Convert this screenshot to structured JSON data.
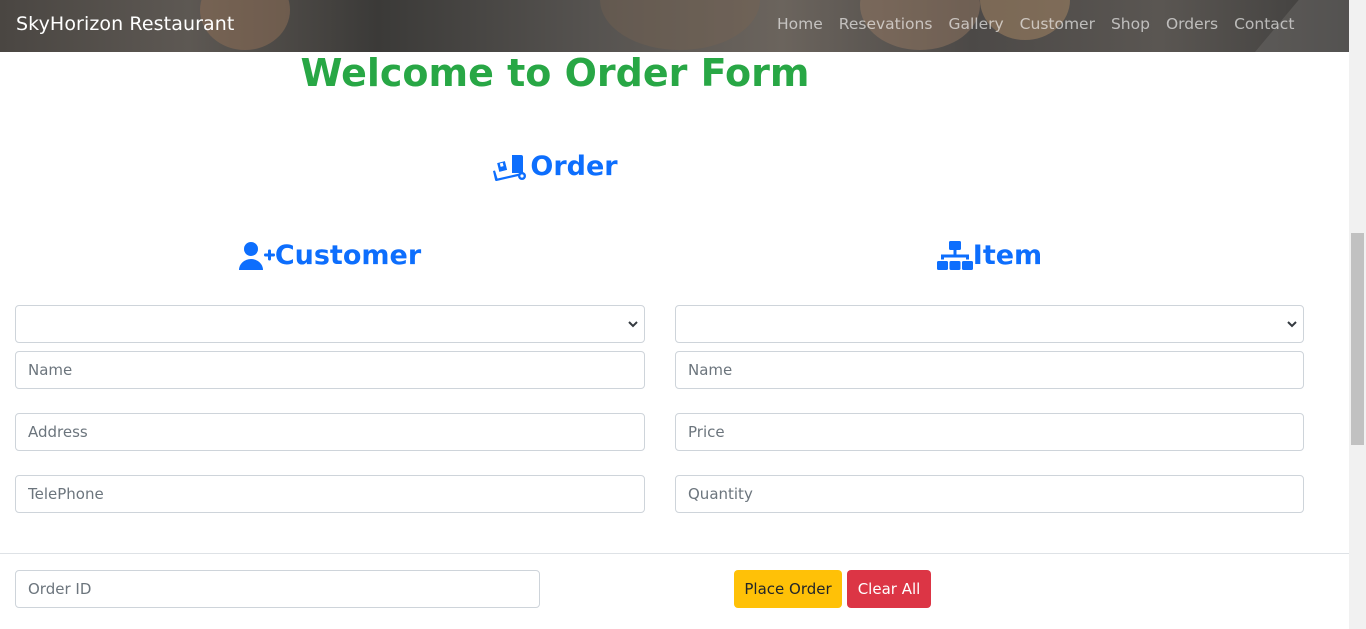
{
  "navbar": {
    "brand": "SkyHorizon Restaurant",
    "links": [
      "Home",
      "Resevations",
      "Gallery",
      "Customer",
      "Shop",
      "Orders",
      "Contact"
    ]
  },
  "page": {
    "welcome": "Welcome to Order Form",
    "order_heading": "Order",
    "customer_heading": "Customer",
    "item_heading": "Item"
  },
  "customer": {
    "select_value": "",
    "name_placeholder": "Name",
    "address_placeholder": "Address",
    "telephone_placeholder": "TelePhone"
  },
  "item": {
    "select_value": "",
    "name_placeholder": "Name",
    "price_placeholder": "Price",
    "quantity_placeholder": "Quantity"
  },
  "order": {
    "order_id_placeholder": "Order ID",
    "place_order_label": "Place Order",
    "clear_all_label": "Clear All"
  },
  "icons": {
    "order": "truck-loading-icon",
    "customer": "user-plus-icon",
    "item": "sitemap-icon",
    "select_arrow": "chevron-down-icon"
  },
  "colors": {
    "welcome": "#28a745",
    "heading": "#0d6efd",
    "warning": "#ffc107",
    "danger": "#dc3545",
    "navbar_text": "#ffffff"
  }
}
